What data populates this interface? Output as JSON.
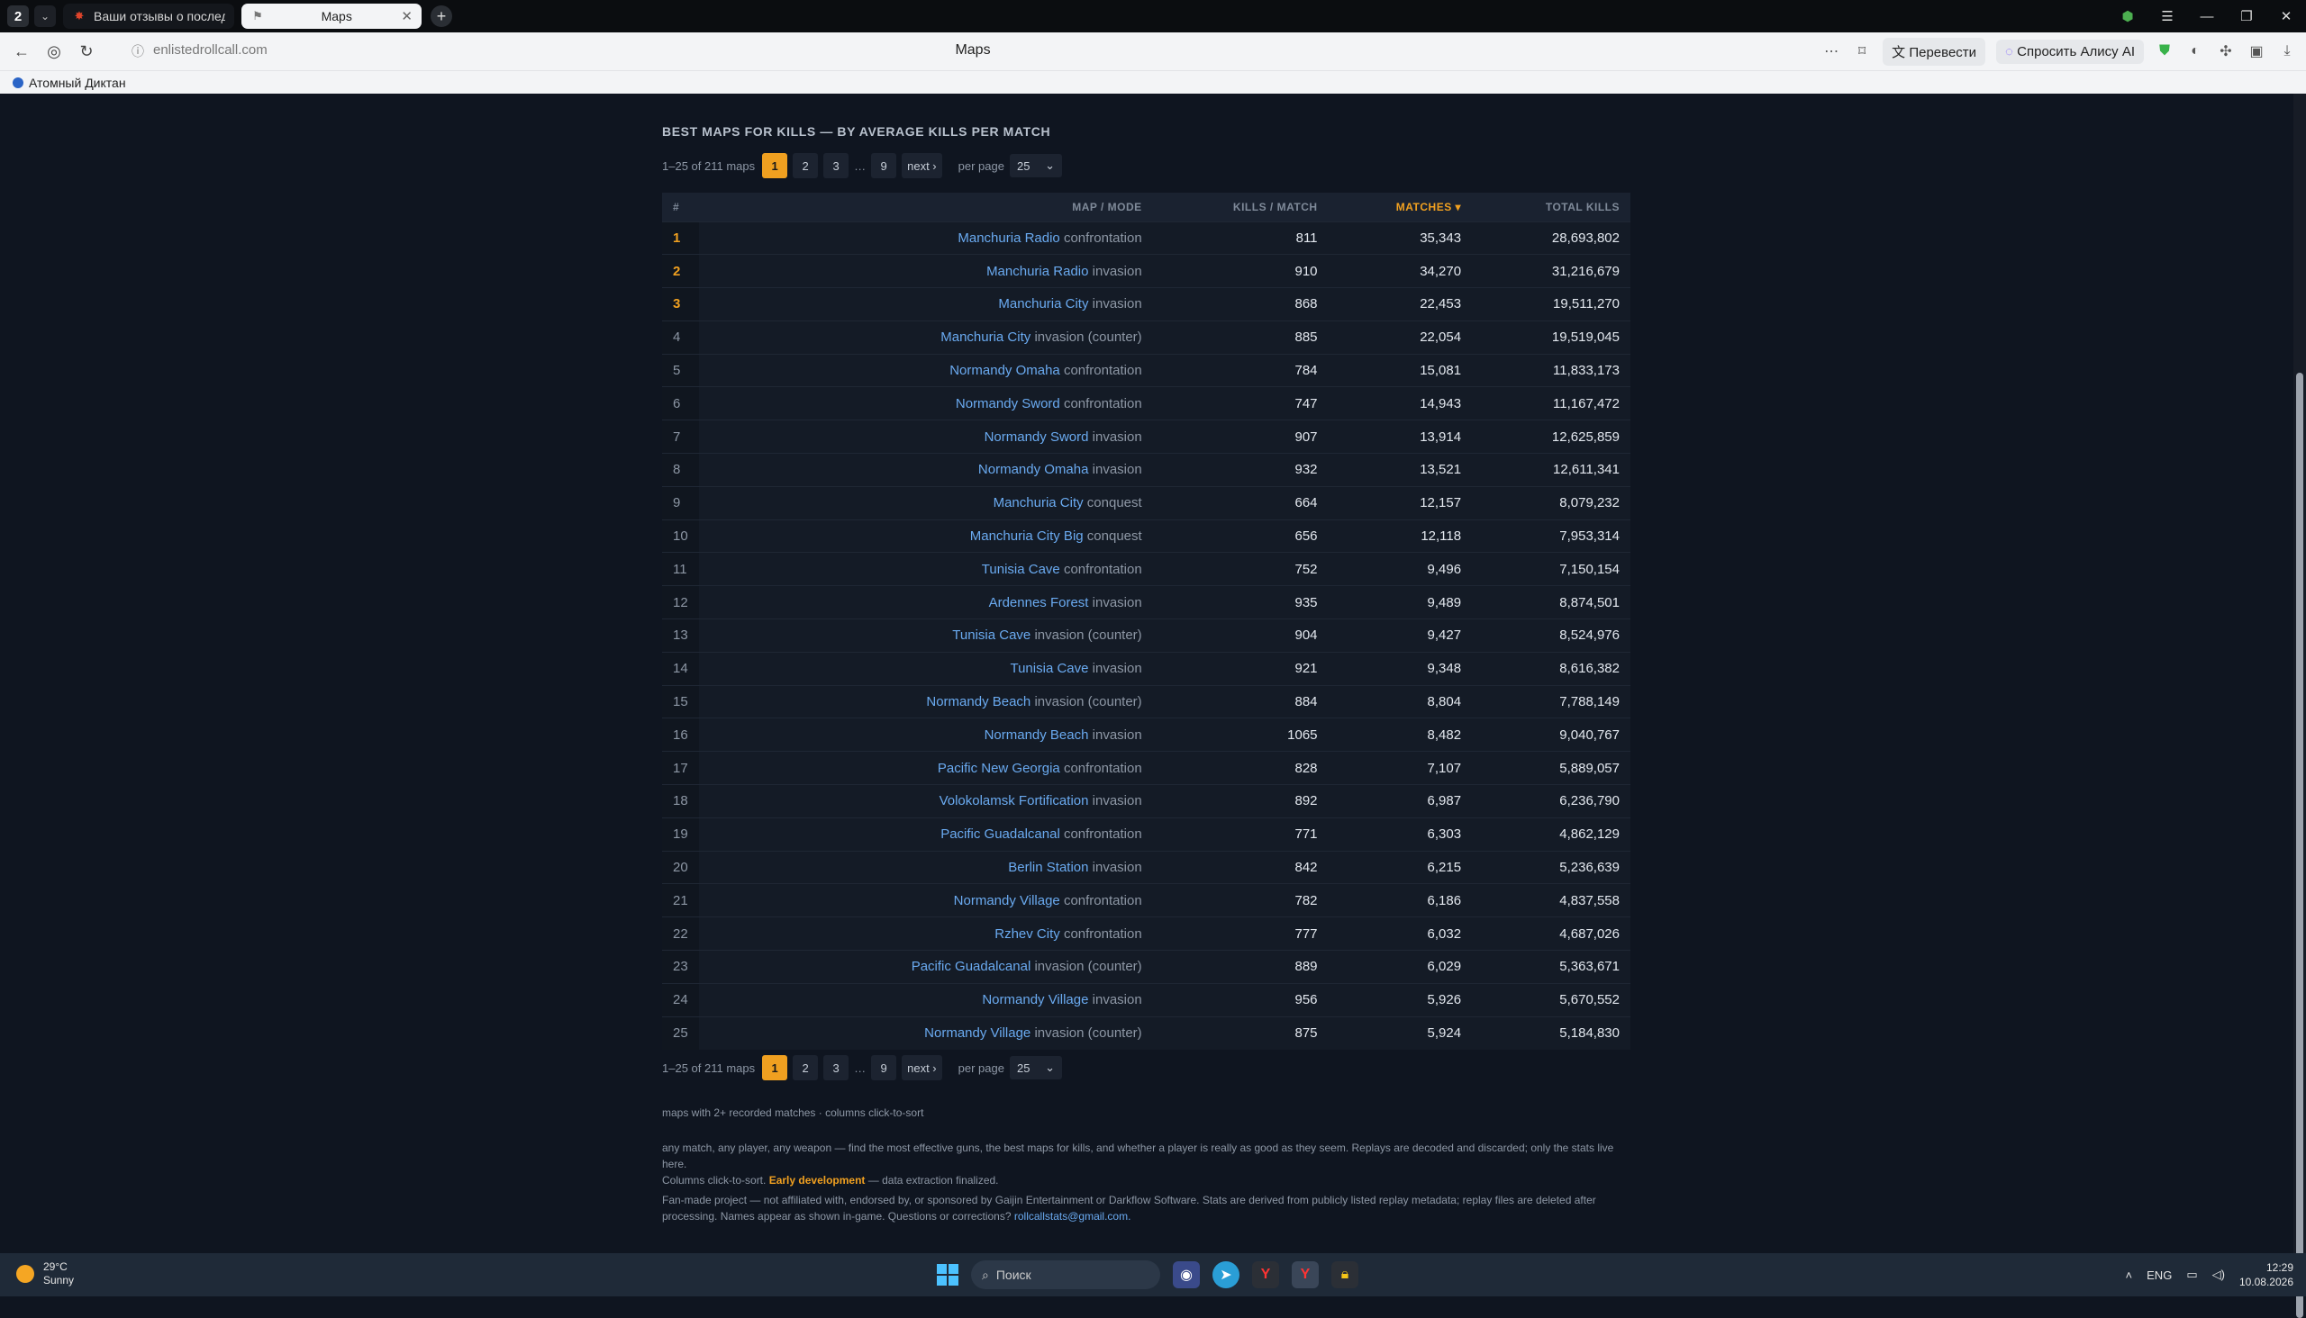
{
  "browser": {
    "tab_count": "2",
    "tabs": [
      {
        "label": "Ваши отзывы о последн",
        "active": false
      },
      {
        "label": "Maps",
        "active": true
      }
    ],
    "url": "enlistedrollcall.com",
    "page_title": "Maps",
    "translate_label": "Перевести",
    "alice_label": "Спросить Алису AI",
    "bookmark": "Атомный Диктан"
  },
  "page": {
    "heading": "BEST MAPS FOR KILLS — BY AVERAGE KILLS PER MATCH",
    "pager": {
      "range": "1–25 of 211 maps",
      "pages": [
        "1",
        "2",
        "3"
      ],
      "ellipsis": "…",
      "last": "9",
      "next": "next ›",
      "per_page_label": "per page",
      "per_page_value": "25"
    },
    "columns": {
      "rank": "#",
      "map": "MAP / MODE",
      "kills": "KILLS / MATCH",
      "matches": "MATCHES ▾",
      "total": "TOTAL KILLS"
    },
    "rows": [
      {
        "rank": "1",
        "map": "Manchuria Radio",
        "mode": "confrontation",
        "kpm": "811",
        "matches": "35,343",
        "total": "28,693,802"
      },
      {
        "rank": "2",
        "map": "Manchuria Radio",
        "mode": "invasion",
        "kpm": "910",
        "matches": "34,270",
        "total": "31,216,679"
      },
      {
        "rank": "3",
        "map": "Manchuria City",
        "mode": "invasion",
        "kpm": "868",
        "matches": "22,453",
        "total": "19,511,270"
      },
      {
        "rank": "4",
        "map": "Manchuria City",
        "mode": "invasion (counter)",
        "kpm": "885",
        "matches": "22,054",
        "total": "19,519,045"
      },
      {
        "rank": "5",
        "map": "Normandy Omaha",
        "mode": "confrontation",
        "kpm": "784",
        "matches": "15,081",
        "total": "11,833,173"
      },
      {
        "rank": "6",
        "map": "Normandy Sword",
        "mode": "confrontation",
        "kpm": "747",
        "matches": "14,943",
        "total": "11,167,472"
      },
      {
        "rank": "7",
        "map": "Normandy Sword",
        "mode": "invasion",
        "kpm": "907",
        "matches": "13,914",
        "total": "12,625,859"
      },
      {
        "rank": "8",
        "map": "Normandy Omaha",
        "mode": "invasion",
        "kpm": "932",
        "matches": "13,521",
        "total": "12,611,341"
      },
      {
        "rank": "9",
        "map": "Manchuria City",
        "mode": "conquest",
        "kpm": "664",
        "matches": "12,157",
        "total": "8,079,232"
      },
      {
        "rank": "10",
        "map": "Manchuria City Big",
        "mode": "conquest",
        "kpm": "656",
        "matches": "12,118",
        "total": "7,953,314"
      },
      {
        "rank": "11",
        "map": "Tunisia Cave",
        "mode": "confrontation",
        "kpm": "752",
        "matches": "9,496",
        "total": "7,150,154"
      },
      {
        "rank": "12",
        "map": "Ardennes Forest",
        "mode": "invasion",
        "kpm": "935",
        "matches": "9,489",
        "total": "8,874,501"
      },
      {
        "rank": "13",
        "map": "Tunisia Cave",
        "mode": "invasion (counter)",
        "kpm": "904",
        "matches": "9,427",
        "total": "8,524,976"
      },
      {
        "rank": "14",
        "map": "Tunisia Cave",
        "mode": "invasion",
        "kpm": "921",
        "matches": "9,348",
        "total": "8,616,382"
      },
      {
        "rank": "15",
        "map": "Normandy Beach",
        "mode": "invasion (counter)",
        "kpm": "884",
        "matches": "8,804",
        "total": "7,788,149"
      },
      {
        "rank": "16",
        "map": "Normandy Beach",
        "mode": "invasion",
        "kpm": "1065",
        "matches": "8,482",
        "total": "9,040,767"
      },
      {
        "rank": "17",
        "map": "Pacific New Georgia",
        "mode": "confrontation",
        "kpm": "828",
        "matches": "7,107",
        "total": "5,889,057"
      },
      {
        "rank": "18",
        "map": "Volokolamsk Fortification",
        "mode": "invasion",
        "kpm": "892",
        "matches": "6,987",
        "total": "6,236,790"
      },
      {
        "rank": "19",
        "map": "Pacific Guadalcanal",
        "mode": "confrontation",
        "kpm": "771",
        "matches": "6,303",
        "total": "4,862,129"
      },
      {
        "rank": "20",
        "map": "Berlin Station",
        "mode": "invasion",
        "kpm": "842",
        "matches": "6,215",
        "total": "5,236,639"
      },
      {
        "rank": "21",
        "map": "Normandy Village",
        "mode": "confrontation",
        "kpm": "782",
        "matches": "6,186",
        "total": "4,837,558"
      },
      {
        "rank": "22",
        "map": "Rzhev City",
        "mode": "confrontation",
        "kpm": "777",
        "matches": "6,032",
        "total": "4,687,026"
      },
      {
        "rank": "23",
        "map": "Pacific Guadalcanal",
        "mode": "invasion (counter)",
        "kpm": "889",
        "matches": "6,029",
        "total": "5,363,671"
      },
      {
        "rank": "24",
        "map": "Normandy Village",
        "mode": "invasion",
        "kpm": "956",
        "matches": "5,926",
        "total": "5,670,552"
      },
      {
        "rank": "25",
        "map": "Normandy Village",
        "mode": "invasion (counter)",
        "kpm": "875",
        "matches": "5,924",
        "total": "5,184,830"
      }
    ],
    "note_sort": "maps with 2+ recorded matches · columns click-to-sort",
    "about_1": "any match, any player, any weapon — find the most effective guns, the best maps for kills, and whether a player is really as good as they seem. Replays are decoded and discarded; only the stats live here.",
    "about_2a": "Columns click-to-sort.",
    "about_2b": "Early development",
    "about_2c": "— data extraction finalized.",
    "legal_1": "Fan-made project — not affiliated with, endorsed by, or sponsored by Gaijin Entertainment or Darkflow Software. Stats are derived from publicly listed replay metadata; replay files are deleted after",
    "legal_2": "processing. Names appear as shown in-game. Questions or corrections?",
    "email": "rollcallstats@gmail.com."
  },
  "taskbar": {
    "temp": "29°C",
    "weather": "Sunny",
    "search_placeholder": "Поиск",
    "lang": "ENG",
    "time": "12:29",
    "date": "10.08.2026"
  }
}
